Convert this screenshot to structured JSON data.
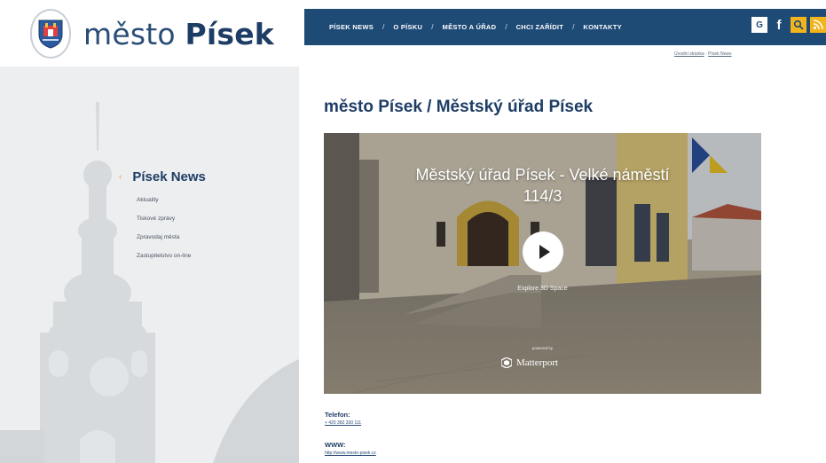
{
  "header": {
    "logo_light": "město",
    "logo_bold": "Písek",
    "nav": [
      "PÍSEK NEWS",
      "O PÍSKU",
      "MĚSTO A ÚŘAD",
      "CHCI ZAŘÍDIT",
      "KONTAKTY"
    ],
    "nav_separator": "/",
    "social": {
      "google": "G",
      "facebook": "f",
      "search": "⌕",
      "rss": "◠"
    }
  },
  "breadcrumb": {
    "first": "Úvodní stránka",
    "sep": " · ",
    "second": "Písek News"
  },
  "sidebar": {
    "marker": "‹",
    "title": "Písek News",
    "items": [
      {
        "label": "Aktuality"
      },
      {
        "label": "Tiskové zprávy"
      },
      {
        "label": "Zpravodaj města"
      },
      {
        "label": "Zastupitelstvo on-line"
      }
    ]
  },
  "main": {
    "title": "město Písek / Městský úřad Písek",
    "video": {
      "title_line1": "Městský úřad Písek - Velké náměstí",
      "title_line2": "114/3",
      "explore": "Explore 3D Space",
      "powered_by": "powered by",
      "brand": "Matterport"
    },
    "contact": {
      "phone_label": "Telefon:",
      "phone_value": "+ 420 382 330 111",
      "web_label": "WWW:",
      "web_value": "http://www.mesto-pisek.cz"
    }
  },
  "colors": {
    "brand_blue": "#1e4a76",
    "accent_yellow": "#f2b41c",
    "title_blue": "#1e3d65"
  }
}
